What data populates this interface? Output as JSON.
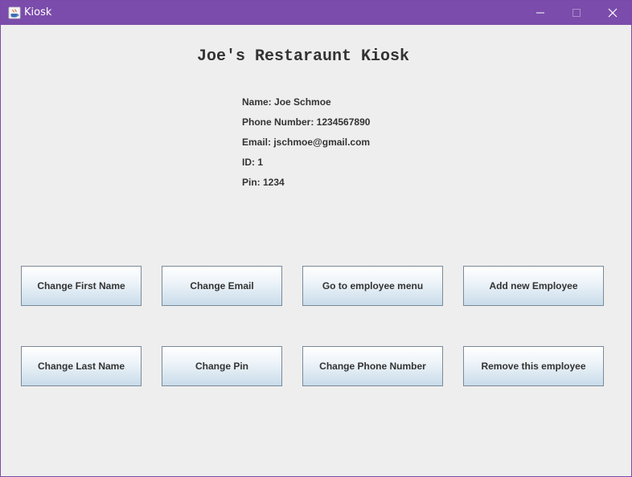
{
  "window": {
    "title": "Kiosk",
    "controls": {
      "minimize_icon": "minimize-icon",
      "maximize_icon": "maximize-icon",
      "close_icon": "close-icon"
    },
    "titlebar_color": "#7b4cab"
  },
  "heading": "Joe's Restaraunt Kiosk",
  "employee_info": {
    "name": "Name: Joe Schmoe",
    "phone": "Phone Number: 1234567890",
    "email": "Email: jschmoe@gmail.com",
    "id": "ID: 1",
    "pin": "Pin: 1234"
  },
  "buttons": {
    "change_first_name": "Change First Name",
    "change_email": "Change Email",
    "employee_menu": "Go to employee menu",
    "add_employee": "Add new Employee",
    "change_last_name": "Change Last Name",
    "change_pin": "Change Pin",
    "change_phone": "Change Phone Number",
    "remove_employee": "Remove this employee"
  }
}
